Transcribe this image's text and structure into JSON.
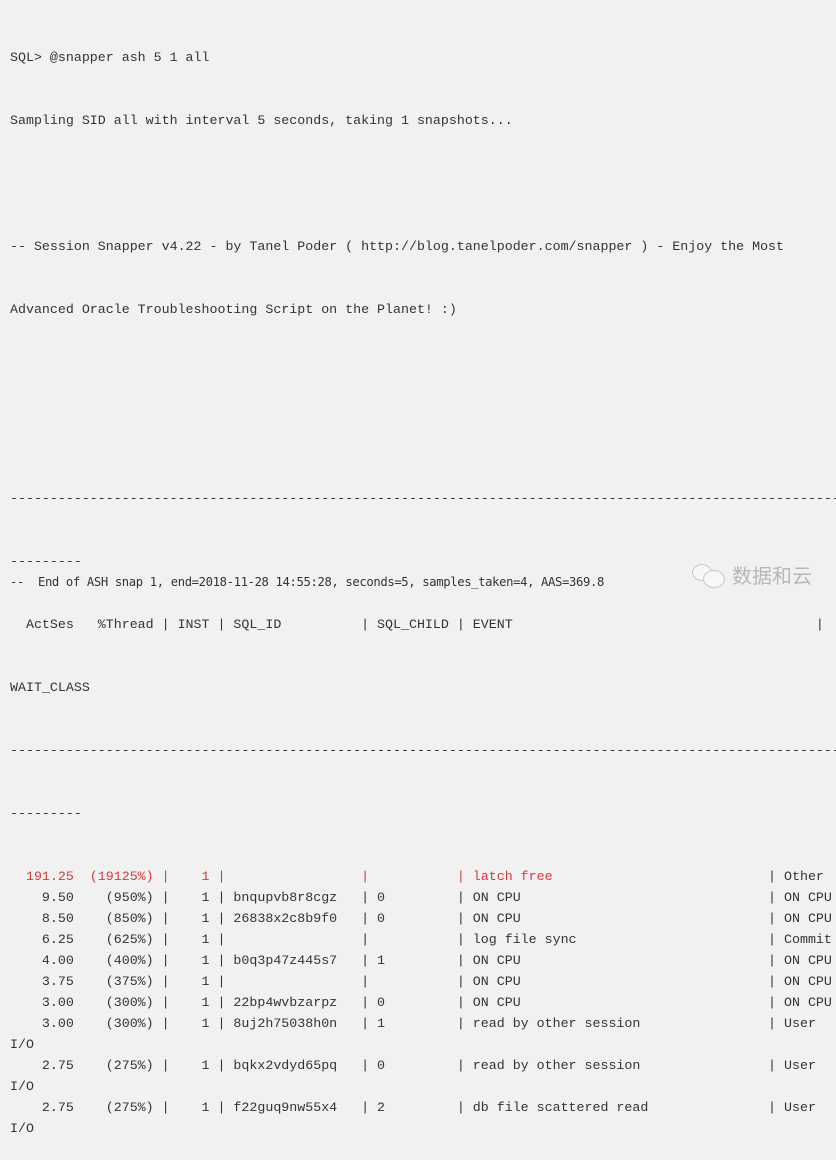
{
  "console": {
    "command": "SQL> @snapper ash 5 1 all",
    "sampling_msg": "Sampling SID all with interval 5 seconds, taking 1 snapshots...",
    "banner_line1": "-- Session Snapper v4.22 - by Tanel Poder ( http://blog.tanelpoder.com/snapper ) - Enjoy the Most",
    "banner_line2": "Advanced Oracle Troubleshooting Script on the Planet! :)",
    "separator_long": "----------------------------------------------------------------------------------------------------------",
    "separator_wrap": "---------",
    "header_line": "  ActSes   %Thread | INST | SQL_ID          | SQL_CHILD | EVENT                                      |",
    "header_wrap": "WAIT_CLASS",
    "rows": [
      {
        "actses": "191.25",
        "pct": "(19125%)",
        "inst": "1",
        "sql_id": "",
        "sql_child": "",
        "event": "latch free",
        "wait_class": "Other",
        "highlight": true
      },
      {
        "actses": "9.50",
        "pct": "(950%)",
        "inst": "1",
        "sql_id": "bnqupvb8r8cgz",
        "sql_child": "0",
        "event": "ON CPU",
        "wait_class": "ON CPU"
      },
      {
        "actses": "8.50",
        "pct": "(850%)",
        "inst": "1",
        "sql_id": "26838x2c8b9f0",
        "sql_child": "0",
        "event": "ON CPU",
        "wait_class": "ON CPU"
      },
      {
        "actses": "6.25",
        "pct": "(625%)",
        "inst": "1",
        "sql_id": "",
        "sql_child": "",
        "event": "log file sync",
        "wait_class": "Commit"
      },
      {
        "actses": "4.00",
        "pct": "(400%)",
        "inst": "1",
        "sql_id": "b0q3p47z445s7",
        "sql_child": "1",
        "event": "ON CPU",
        "wait_class": "ON CPU"
      },
      {
        "actses": "3.75",
        "pct": "(375%)",
        "inst": "1",
        "sql_id": "",
        "sql_child": "",
        "event": "ON CPU",
        "wait_class": "ON CPU"
      },
      {
        "actses": "3.00",
        "pct": "(300%)",
        "inst": "1",
        "sql_id": "22bp4wvbzarpz",
        "sql_child": "0",
        "event": "ON CPU",
        "wait_class": "ON CPU"
      },
      {
        "actses": "3.00",
        "pct": "(300%)",
        "inst": "1",
        "sql_id": "8uj2h75038h0n",
        "sql_child": "1",
        "event": "read by other session",
        "wait_class": "User",
        "wrap": "I/O"
      },
      {
        "actses": "2.75",
        "pct": "(275%)",
        "inst": "1",
        "sql_id": "bqkx2vdyd65pq",
        "sql_child": "0",
        "event": "read by other session",
        "wait_class": "User",
        "wrap": "I/O"
      },
      {
        "actses": "2.75",
        "pct": "(275%)",
        "inst": "1",
        "sql_id": "f22guq9nw55x4",
        "sql_child": "2",
        "event": "db file scattered read",
        "wait_class": "User",
        "wrap": "I/O"
      }
    ],
    "footer": "--  End of ASH snap 1, end=2018-11-28 14:55:28, seconds=5, samples_taken=4, AAS=369.8"
  },
  "watermark": {
    "icon": "wechat-icon",
    "text": "数据和云"
  },
  "colors": {
    "background": "#f1f1f1",
    "text": "#333333",
    "highlight": "#d9383d"
  }
}
